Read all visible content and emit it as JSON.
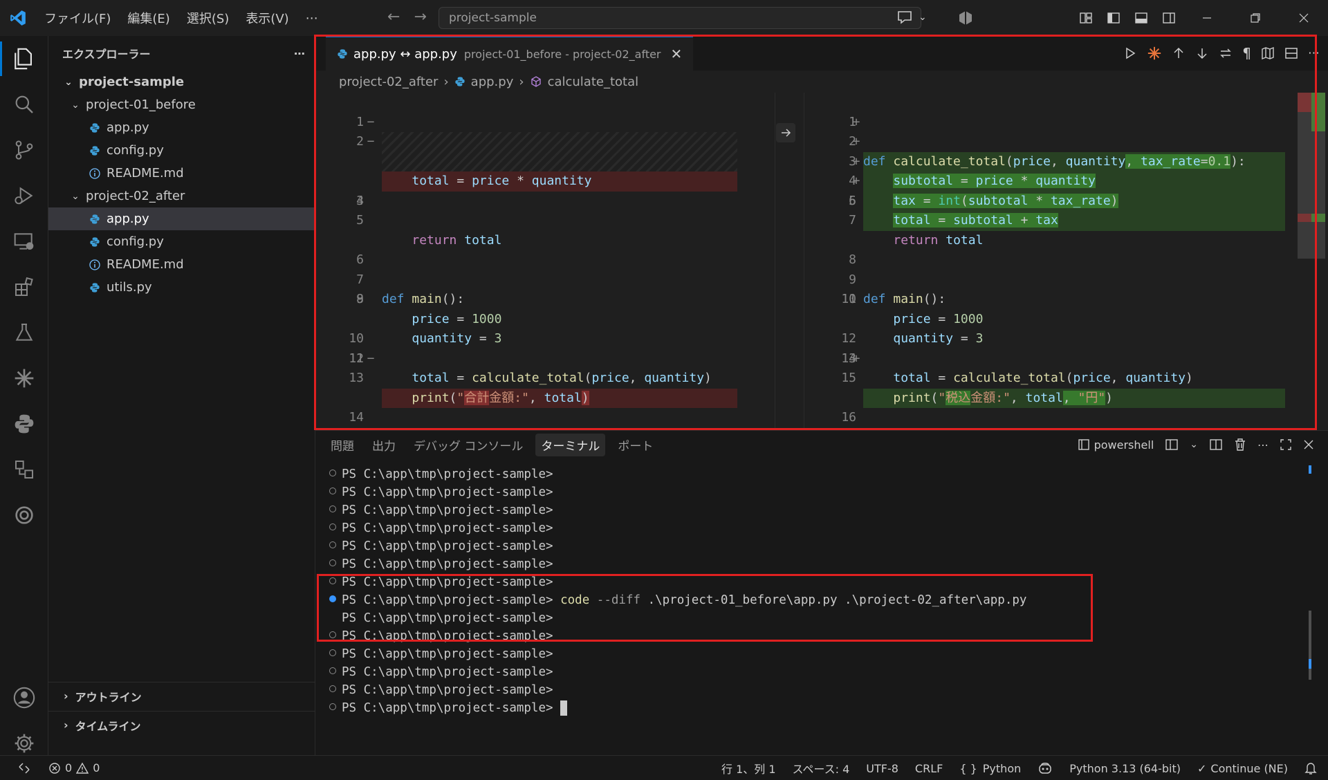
{
  "titlebar": {
    "menu": [
      "ファイル(F)",
      "編集(E)",
      "選択(S)",
      "表示(V)",
      "⋯"
    ],
    "search_text": "project-sample"
  },
  "sidebar": {
    "title": "エクスプローラー",
    "root": "project-sample",
    "folder1": "project-01_before",
    "folder1_files": [
      "app.py",
      "config.py",
      "README.md"
    ],
    "folder2": "project-02_after",
    "folder2_files": [
      "app.py",
      "config.py",
      "README.md",
      "utils.py"
    ],
    "outline": "アウトライン",
    "timeline": "タイムライン"
  },
  "editor": {
    "tab_name": "app.py ↔ app.py",
    "tab_desc": "project-01_before - project-02_after",
    "breadcrumb": [
      "project-02_after",
      "app.py",
      "calculate_total"
    ]
  },
  "panel": {
    "tabs": [
      "問題",
      "出力",
      "デバッグ コンソール",
      "ターミナル",
      "ポート"
    ],
    "active_tab": "ターミナル",
    "shell": "powershell",
    "prompt": "PS C:\\app\\tmp\\project-sample>",
    "command": "code",
    "command_flag": "--diff",
    "command_args": ".\\project-01_before\\app.py .\\project-02_after\\app.py"
  },
  "statusbar": {
    "errors": "0",
    "warnings": "0",
    "position": "行 1、列 1",
    "spaces": "スペース: 4",
    "encoding": "UTF-8",
    "eol": "CRLF",
    "language": "Python",
    "interpreter": "Python 3.13 (64-bit)",
    "continue": "Continue (NE)"
  },
  "colors": {
    "accent": "#0078d4",
    "highlight_box": "#e02020",
    "deleted": "#782323",
    "added": "#326428"
  }
}
